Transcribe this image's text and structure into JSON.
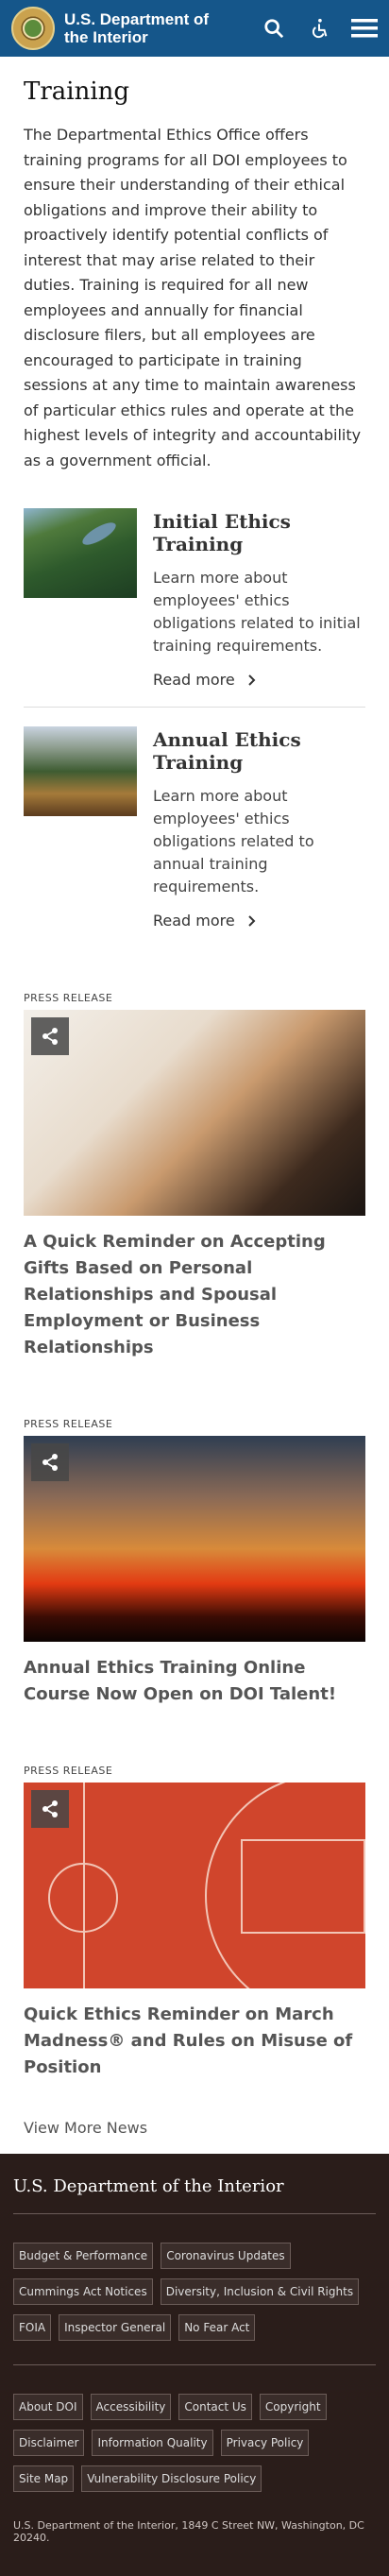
{
  "header": {
    "title": "U.S. Department of the Interior",
    "icons": [
      "seal-logo",
      "search-icon",
      "accessibility-icon",
      "menu-icon"
    ]
  },
  "page": {
    "title": "Training",
    "intro": "The Departmental Ethics Office offers training programs for all DOI employees to ensure their understanding of their ethical obligations and improve their ability to proactively identify potential conflicts of interest that may arise related to their duties.  Training is required for all new employees and annually for financial disclosure filers, but all employees are encouraged to participate in training sessions at any time to maintain awareness of particular ethics rules and operate at the highest levels of integrity and accountability as a government official."
  },
  "features": [
    {
      "title": "Initial Ethics Training",
      "description": "Learn more about employees' ethics obligations related to initial training requirements.",
      "link": "Read more"
    },
    {
      "title": "Annual Ethics Training",
      "description": "Learn more about employees' ethics obligations related to annual training requirements.",
      "link": "Read more"
    }
  ],
  "news": [
    {
      "label": "PRESS RELEASE",
      "title": "A Quick Reminder on Accepting Gifts Based on Personal Relationships and Spousal Employment or Business Relationships"
    },
    {
      "label": "PRESS RELEASE",
      "title": "Annual Ethics Training Online Course Now Open on DOI Talent!"
    },
    {
      "label": "PRESS RELEASE",
      "title": "Quick Ethics Reminder on March Madness® and Rules on Misuse of Position"
    }
  ],
  "view_more": "View More News",
  "footer": {
    "title": "U.S. Department of the Interior",
    "group1": [
      "Budget & Performance",
      "Coronavirus Updates",
      "Cummings Act Notices",
      "Diversity, Inclusion & Civil Rights",
      "FOIA",
      "Inspector General",
      "No Fear Act"
    ],
    "group2": [
      "About DOI",
      "Accessibility",
      "Contact Us",
      "Copyright",
      "Disclaimer",
      "Information Quality",
      "Privacy Policy",
      "Site Map",
      "Vulnerability Disclosure Policy"
    ],
    "address": "U.S. Department of the Interior, 1849 C Street NW, Washington, DC 20240."
  },
  "colors": {
    "header_bg": "#15568a",
    "footer_bg": "#2a1d1a"
  }
}
